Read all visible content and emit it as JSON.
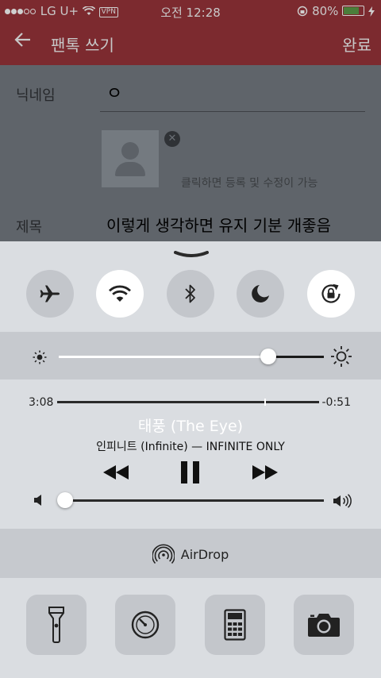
{
  "status_bar": {
    "carrier": "LG U+",
    "vpn": "VPN",
    "time": "오전 12:28",
    "battery": "80%"
  },
  "app_bar": {
    "title": "팬톡 쓰기",
    "done_label": "완료"
  },
  "form": {
    "nickname_label": "닉네임",
    "nickname_value": "ㅇ",
    "photo_hint": "클릭하면 등록 및 수정이 가능",
    "subject_label": "제목",
    "subject_value": "이렇게 생각하면 유지 기분 개좋음"
  },
  "control_center": {
    "toggles": [
      {
        "name": "airplane-mode",
        "icon": "airplane-icon",
        "on": false
      },
      {
        "name": "wifi",
        "icon": "wifi-icon",
        "on": true
      },
      {
        "name": "bluetooth",
        "icon": "bluetooth-icon",
        "on": false
      },
      {
        "name": "do-not-disturb",
        "icon": "moon-icon",
        "on": false
      },
      {
        "name": "rotation-lock",
        "icon": "rotation-lock-icon",
        "on": true
      }
    ],
    "brightness_level": 0.79,
    "now_playing": {
      "elapsed": "3:08",
      "remaining": "-0:51",
      "progress": 0.79,
      "title": "태풍 (The Eye)",
      "subtitle": "인피니트 (Infinite) — INFINITE ONLY"
    },
    "volume_level": 0.0,
    "airdrop_label": "AirDrop",
    "shortcuts": [
      "flashlight-icon",
      "timer-icon",
      "calculator-icon",
      "camera-icon"
    ]
  }
}
